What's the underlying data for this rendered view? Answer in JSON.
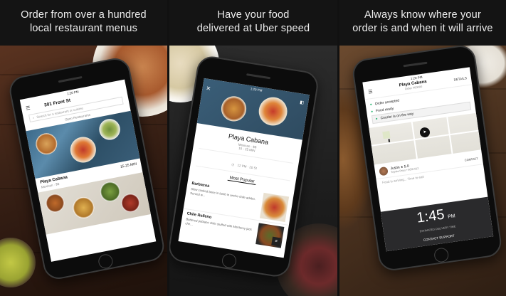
{
  "panels": [
    {
      "caption_line1": "Order from over a hundred",
      "caption_line2": "local restaurant menus",
      "screen": {
        "time": "1:20 PM",
        "address": "301 Front St",
        "search_placeholder": "Search for a restaurant or cuisine",
        "section_label": "Open Restaurants",
        "restaurant_name": "Playa Cabana",
        "restaurant_meta": "Mexican · $$",
        "eta": "15-25 MIN"
      }
    },
    {
      "caption_line1": "Have your food",
      "caption_line2": "delivered at Uber speed",
      "screen": {
        "time": "1:20 PM",
        "restaurant_name": "Playa Cabana",
        "restaurant_meta": "Mexican · $$",
        "eta": "15 - 25 MIN",
        "address": "12 PM · 20 St",
        "section_title": "Most Popular",
        "item1_name": "Barbacoa",
        "item1_desc": "Slow cooked bone in lamb in ancho chile adobo. Served w...",
        "item2_name": "Chile Relleno",
        "item2_desc": "Battered poblano chile stuffed with Monterey jack che..."
      }
    },
    {
      "caption_line1": "Always know where your",
      "caption_line2": "order is and when it will arrive",
      "screen": {
        "time": "1:20 PM",
        "restaurant_name": "Playa Cabana",
        "order_id": "Order #00000",
        "details_label": "DETAILS",
        "steps": [
          "Order accepted",
          "Food ready",
          "Courier is on the way"
        ],
        "courier_name": "Justin",
        "courier_rating": "5.0",
        "courier_vehicle": "Toyota Prius • 6GB-012",
        "contact_label": "CONTACT",
        "arriving_text": "Food is arriving... Time to eat!",
        "eta_time": "1:45",
        "eta_suffix": "PM",
        "eta_label": "ESTIMATED DELIVERY TIME",
        "support_label": "CONTACT SUPPORT"
      }
    }
  ]
}
